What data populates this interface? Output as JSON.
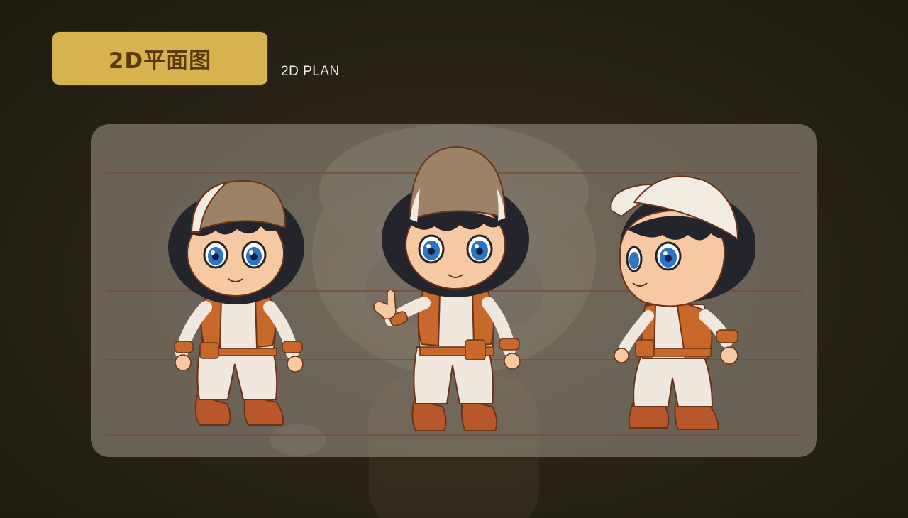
{
  "header": {
    "title": "2D平面图",
    "subtitle": "2D PLAN"
  },
  "panel": {
    "figures": [
      {
        "view": "front-left",
        "icon": "character-three-quarter-left"
      },
      {
        "view": "front",
        "icon": "character-front-waving"
      },
      {
        "view": "side-right",
        "icon": "character-three-quarter-right"
      }
    ]
  },
  "colors": {
    "badge": "#d8b24e",
    "badge_text": "#5a3a0c",
    "vest": "#c8682a",
    "shirt": "#f0e8df",
    "cap_beige": "#9c8266",
    "cap_white": "#f2ece2",
    "hair": "#24242c",
    "skin": "#f6c9a2",
    "eyes": "#2c74c4",
    "boots": "#b8582a",
    "guide_lines": "#7a4a3c"
  }
}
